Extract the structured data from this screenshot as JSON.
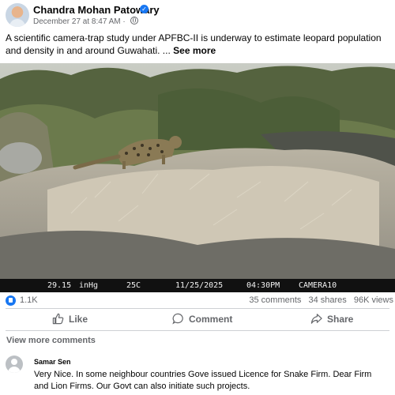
{
  "post": {
    "author": "Chandra Mohan Patowary",
    "date": "December 27 at 8:47 AM",
    "separator": "·",
    "caption": "A scientific camera-trap study under APFBC-II is underway to estimate leopard population and density in and around Guwahati. ...",
    "see_more": "See more"
  },
  "camera_overlay": {
    "field1": "29.15",
    "field2": "inHg",
    "field3": "25C",
    "date": "11/25/2025",
    "time": "04:30PM",
    "camera": "CAMERA10"
  },
  "stats": {
    "reactions": "1.1K",
    "comments": "35 comments",
    "shares": "34 shares",
    "views": "96K views"
  },
  "actions": {
    "like": "Like",
    "comment": "Comment",
    "share": "Share"
  },
  "view_more_comments": "View more comments",
  "comment": {
    "author": "Samar Sen",
    "text": "Very Nice. In some neighbour countries Gove issued Licence for Snake Firm. Dear Firm and Lion Firms. Our Govt can also initiate such projects."
  },
  "colors": {
    "accent": "#1877f2",
    "secondary_text": "#65676b"
  }
}
